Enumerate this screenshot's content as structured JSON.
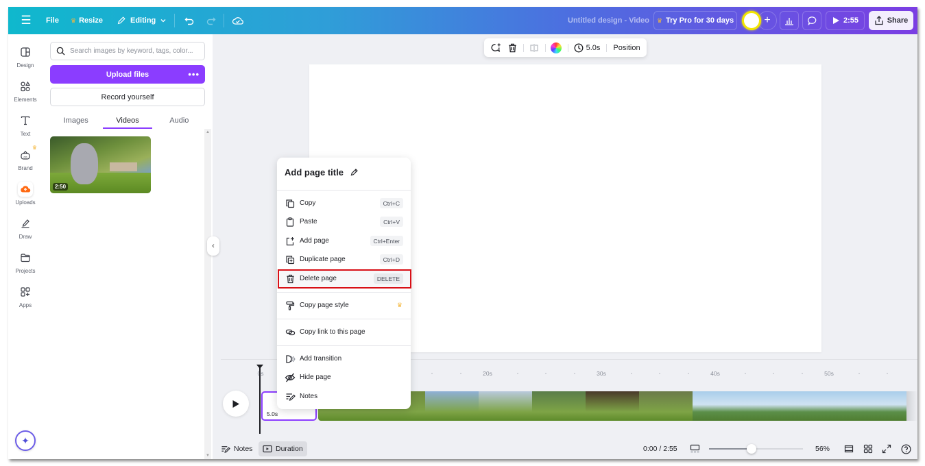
{
  "topbar": {
    "file": "File",
    "resize": "Resize",
    "editing": "Editing",
    "title": "Untitled design - Video",
    "try_pro": "Try Pro for 30 days",
    "play_duration": "2:55",
    "share": "Share"
  },
  "rail": [
    {
      "label": "Design",
      "icon": "design-icon"
    },
    {
      "label": "Elements",
      "icon": "elements-icon"
    },
    {
      "label": "Text",
      "icon": "text-icon"
    },
    {
      "label": "Brand",
      "icon": "brand-icon"
    },
    {
      "label": "Uploads",
      "icon": "uploads-icon"
    },
    {
      "label": "Draw",
      "icon": "draw-icon"
    },
    {
      "label": "Projects",
      "icon": "projects-icon"
    },
    {
      "label": "Apps",
      "icon": "apps-icon"
    }
  ],
  "panel": {
    "search_placeholder": "Search images by keyword, tags, color...",
    "upload_label": "Upload files",
    "upload_more": "•••",
    "record_label": "Record yourself",
    "tabs": [
      "Images",
      "Videos",
      "Audio"
    ],
    "active_tab": "Videos",
    "video_thumb": {
      "duration": "2:50"
    }
  },
  "float_toolbar": {
    "duration": "5.0s",
    "position": "Position"
  },
  "context_menu": {
    "title": "Add page title",
    "items": [
      {
        "label": "Copy",
        "shortcut": "Ctrl+C",
        "icon": "copy-icon"
      },
      {
        "label": "Paste",
        "shortcut": "Ctrl+V",
        "icon": "paste-icon"
      },
      {
        "label": "Add page",
        "shortcut": "Ctrl+Enter",
        "icon": "add-page-icon"
      },
      {
        "label": "Duplicate page",
        "shortcut": "Ctrl+D",
        "icon": "duplicate-page-icon"
      },
      {
        "label": "Delete page",
        "shortcut": "DELETE",
        "icon": "trash-icon",
        "highlighted": true
      },
      {
        "label": "Copy page style",
        "icon": "paint-roller-icon",
        "pro": true
      },
      {
        "label": "Copy link to this page",
        "icon": "link-icon"
      },
      {
        "label": "Add transition",
        "icon": "transition-icon"
      },
      {
        "label": "Hide page",
        "icon": "eye-slash-icon"
      },
      {
        "label": "Notes",
        "icon": "notes-icon"
      }
    ]
  },
  "timeline": {
    "ticks": [
      "0s",
      "20s",
      "30s",
      "40s",
      "50s"
    ],
    "selected_clip_duration": "5.0s",
    "frame_colors": [
      "#5f7c3a",
      "#6e8a3e",
      "#8fb0d6",
      "#b8c9dc",
      "#5a7d4a",
      "#4a3a2a",
      "#6b7a4a",
      "#9ec4e0",
      "#9ec4e0",
      "#9ec4e0",
      "#9ec4e0"
    ]
  },
  "bottombar": {
    "notes": "Notes",
    "duration": "Duration",
    "time": "0:00 / 2:55",
    "zoom_percent": "56%",
    "zoom_value": 0.45
  },
  "colors": {
    "accent": "#8b3dff",
    "highlight_border": "#d80f16",
    "crown": "#f4b73d"
  }
}
